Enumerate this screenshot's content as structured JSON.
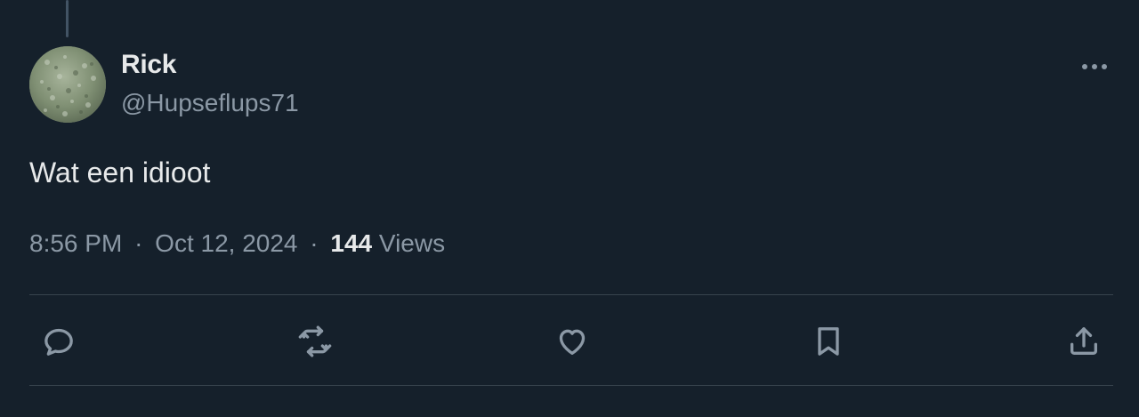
{
  "tweet": {
    "display_name": "Rick",
    "handle": "@Hupseflups71",
    "text": "Wat een idioot",
    "time": "8:56 PM",
    "separator": "·",
    "date": "Oct 12, 2024",
    "views_count": "144",
    "views_label": "Views"
  },
  "icons": {
    "more": "more-horizontal-icon",
    "reply": "reply-icon",
    "retweet": "retweet-icon",
    "like": "heart-icon",
    "bookmark": "bookmark-icon",
    "share": "share-icon"
  },
  "colors": {
    "background": "#15202b",
    "primary_text": "#e7e9ea",
    "secondary_text": "#8b98a5",
    "divider": "#38444d"
  }
}
